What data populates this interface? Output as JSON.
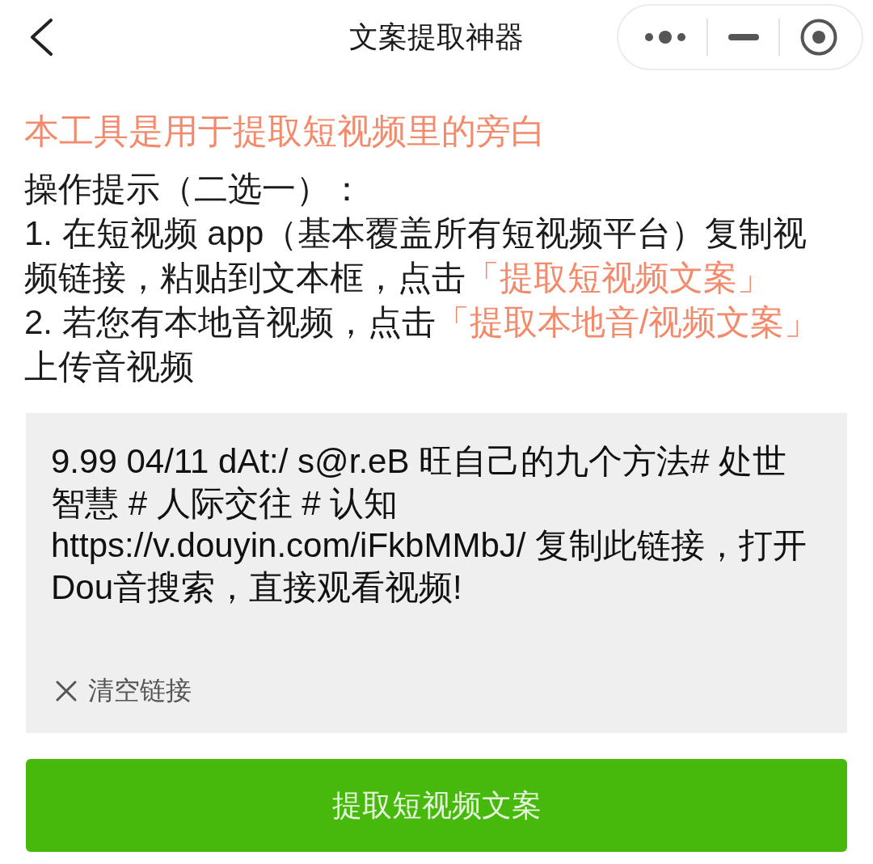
{
  "nav_bar": {
    "title": "文案提取神器"
  },
  "intro": {
    "headline": "本工具是用于提取短视频里的旁白",
    "tips_title": "操作提示（二选一）：",
    "steps": [
      {
        "segments": [
          {
            "kind": "plain",
            "text": "1. 在短视频 app（基本覆盖所有短视频平台）复制视频链接，粘贴到文本框，点击"
          },
          {
            "kind": "highlight",
            "text": "「提取短视频文案」"
          }
        ]
      },
      {
        "segments": [
          {
            "kind": "plain",
            "text": "2. 若您有本地音视频，点击"
          },
          {
            "kind": "highlight",
            "text": "「提取本地音/视频文案」"
          },
          {
            "kind": "plain",
            "text": "上传音视频"
          }
        ]
      }
    ]
  },
  "link_input": {
    "value": "9.99 04/11 dAt:/ s@r.eB 旺自己的九个方法# 处世智慧 # 人际交往 # 认知 https://v.douyin.com/iFkbMMbJ/ 复制此链接，打开Dou音搜索，直接观看视频!",
    "clear_label": "清空链接"
  },
  "primary_button": {
    "label": "提取短视频文案"
  }
}
